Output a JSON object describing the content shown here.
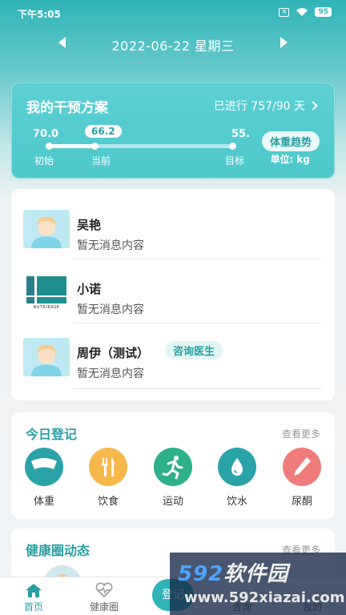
{
  "status_bar": {
    "time": "下午5:05",
    "battery": "95"
  },
  "date_bar": {
    "date": "2022-06-22 星期三"
  },
  "plan": {
    "title": "我的干预方案",
    "progress_text": "已进行 757/90 天",
    "initial_value": "70.0",
    "current_value": "66.2",
    "target_value": "55.",
    "initial_label": "初始",
    "current_label": "当前",
    "target_label": "目标",
    "trend_button": "体重趋势",
    "unit": "单位: kg",
    "progress_fraction": 0.25
  },
  "contacts": [
    {
      "name": "吴艳",
      "message": "暂无消息内容"
    },
    {
      "name": "小诺",
      "message": "暂无消息内容",
      "logo_text": "NUTRIEASE"
    },
    {
      "name": "周伊（测试）",
      "message": "暂无消息内容",
      "tag": "咨询医生"
    }
  ],
  "today": {
    "title": "今日登记",
    "see_more": "查看更多",
    "items": [
      {
        "label": "体重",
        "color": "#2aa3a8",
        "icon": "scale-icon"
      },
      {
        "label": "饮食",
        "color": "#f6b84a",
        "icon": "fork-knife-icon"
      },
      {
        "label": "运动",
        "color": "#2eb08a",
        "icon": "running-icon"
      },
      {
        "label": "饮水",
        "color": "#2aa3a8",
        "icon": "water-drop-icon"
      },
      {
        "label": "尿酮",
        "color": "#f07b7b",
        "icon": "test-strip-icon"
      }
    ]
  },
  "health": {
    "title": "健康圈动态",
    "see_more": "查看更多"
  },
  "watermark": {
    "brand_num": "592",
    "brand_cn": "软件园",
    "url": "www.592xiazai.com"
  },
  "tabs": [
    {
      "label": "首页",
      "icon": "home-icon"
    },
    {
      "label": "健康圈",
      "icon": "heart-pulse-icon"
    },
    {
      "label": "登记",
      "icon": "register-icon"
    },
    {
      "label": "咨询",
      "icon": "consult-icon"
    },
    {
      "label": "我的",
      "icon": "user-icon"
    }
  ],
  "colors": {
    "primary": "#2fb4b8",
    "accent_text": "#2a9fa3"
  }
}
